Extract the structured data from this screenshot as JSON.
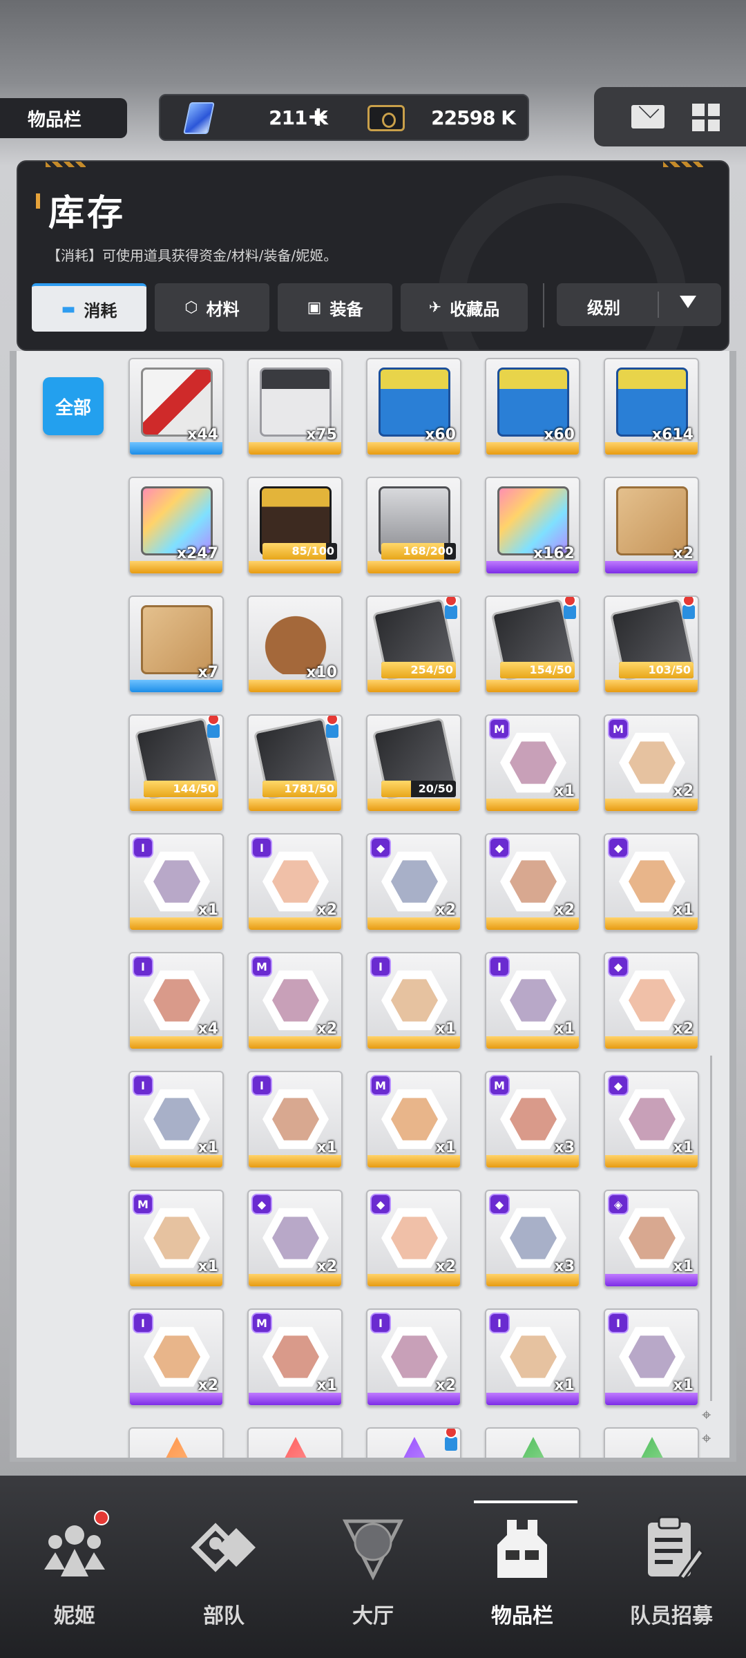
{
  "top": {
    "tab_title": "物品栏",
    "gems": "211 K",
    "gems_plus": "+",
    "credits": "22598 K"
  },
  "header": {
    "title": "库存",
    "description": "【消耗】可使用道具获得资金/材料/装备/妮姬。",
    "tabs": [
      {
        "label": "消耗",
        "icon": "ticket-icon"
      },
      {
        "label": "材料",
        "icon": "hexagon-icon"
      },
      {
        "label": "装备",
        "icon": "vest-icon"
      },
      {
        "label": "收藏品",
        "icon": "bird-icon"
      }
    ],
    "sort_label": "级别"
  },
  "filter_all": "全部",
  "items": [
    {
      "qty": "x44",
      "rarity": "blue",
      "art": "crate-red-icon"
    },
    {
      "qty": "x75",
      "rarity": "gold",
      "art": "crate-purple-icon"
    },
    {
      "qty": "x60",
      "rarity": "gold",
      "art": "blue-box-icon"
    },
    {
      "qty": "x60",
      "rarity": "gold",
      "art": "blue-box-icon"
    },
    {
      "qty": "x614",
      "rarity": "gold",
      "art": "blue-box-icon"
    },
    {
      "qty": "x247",
      "rarity": "gold",
      "art": "rainbow-case-icon"
    },
    {
      "progress": "85/100",
      "rarity": "gold",
      "art": "dark-case-icon"
    },
    {
      "progress": "168/200",
      "rarity": "gold",
      "art": "silver-case-icon"
    },
    {
      "qty": "x162",
      "rarity": "purple",
      "art": "rainbow-case-icon"
    },
    {
      "qty": "x2",
      "rarity": "purple",
      "art": "cardboard-box-icon"
    },
    {
      "qty": "x7",
      "rarity": "blue",
      "art": "cardboard-box-icon"
    },
    {
      "qty": "x10",
      "rarity": "gold",
      "art": "basket-icon"
    },
    {
      "progress": "254/50",
      "rarity": "gold",
      "art": "card-icon",
      "lock": true
    },
    {
      "progress": "154/50",
      "rarity": "gold",
      "art": "card-icon",
      "lock": true
    },
    {
      "progress": "103/50",
      "rarity": "gold",
      "art": "card-icon",
      "lock": true
    },
    {
      "progress": "144/50",
      "rarity": "gold",
      "art": "card-icon",
      "lock": true
    },
    {
      "progress": "1781/50",
      "rarity": "gold",
      "art": "card-icon",
      "lock": true
    },
    {
      "progress": "20/50",
      "rarity": "gold",
      "art": "card-icon"
    },
    {
      "qty": "x1",
      "rarity": "gold",
      "art": "portrait-icon",
      "badge": "M"
    },
    {
      "qty": "x2",
      "rarity": "gold",
      "art": "portrait-icon",
      "badge": "M"
    },
    {
      "qty": "x1",
      "rarity": "gold",
      "art": "portrait-icon",
      "badge": "I"
    },
    {
      "qty": "x2",
      "rarity": "gold",
      "art": "portrait-icon",
      "badge": "I"
    },
    {
      "qty": "x2",
      "rarity": "gold",
      "art": "portrait-icon",
      "badge": "◆"
    },
    {
      "qty": "x2",
      "rarity": "gold",
      "art": "portrait-icon",
      "badge": "◆"
    },
    {
      "qty": "x1",
      "rarity": "gold",
      "art": "portrait-icon",
      "badge": "◆"
    },
    {
      "qty": "x4",
      "rarity": "gold",
      "art": "portrait-icon",
      "badge": "I"
    },
    {
      "qty": "x2",
      "rarity": "gold",
      "art": "portrait-icon",
      "badge": "M"
    },
    {
      "qty": "x1",
      "rarity": "gold",
      "art": "portrait-icon",
      "badge": "I"
    },
    {
      "qty": "x1",
      "rarity": "gold",
      "art": "portrait-icon",
      "badge": "I"
    },
    {
      "qty": "x2",
      "rarity": "gold",
      "art": "portrait-icon",
      "badge": "◆"
    },
    {
      "qty": "x1",
      "rarity": "gold",
      "art": "portrait-icon",
      "badge": "I"
    },
    {
      "qty": "x1",
      "rarity": "gold",
      "art": "portrait-icon",
      "badge": "I"
    },
    {
      "qty": "x1",
      "rarity": "gold",
      "art": "portrait-icon",
      "badge": "M"
    },
    {
      "qty": "x3",
      "rarity": "gold",
      "art": "portrait-icon",
      "badge": "M"
    },
    {
      "qty": "x1",
      "rarity": "gold",
      "art": "portrait-icon",
      "badge": "◆"
    },
    {
      "qty": "x1",
      "rarity": "gold",
      "art": "portrait-icon",
      "badge": "M"
    },
    {
      "qty": "x2",
      "rarity": "gold",
      "art": "portrait-icon",
      "badge": "◆"
    },
    {
      "qty": "x2",
      "rarity": "gold",
      "art": "portrait-icon",
      "badge": "◆"
    },
    {
      "qty": "x3",
      "rarity": "gold",
      "art": "portrait-icon",
      "badge": "◆"
    },
    {
      "qty": "x1",
      "rarity": "purple",
      "art": "portrait-icon",
      "badge": "◈"
    },
    {
      "qty": "x2",
      "rarity": "purple",
      "art": "portrait-icon",
      "badge": "I"
    },
    {
      "qty": "x1",
      "rarity": "purple",
      "art": "portrait-icon",
      "badge": "M"
    },
    {
      "qty": "x2",
      "rarity": "purple",
      "art": "portrait-icon",
      "badge": "I"
    },
    {
      "qty": "x1",
      "rarity": "purple",
      "art": "portrait-icon",
      "badge": "I"
    },
    {
      "qty": "x1",
      "rarity": "purple",
      "art": "portrait-icon",
      "badge": "I"
    },
    {
      "rarity": "orange",
      "art": "orange-shard-icon"
    },
    {
      "rarity": "orange",
      "art": "red-shard-icon"
    },
    {
      "rarity": "purple",
      "art": "purple-shard-icon",
      "lock": true
    },
    {
      "rarity": "green",
      "art": "green-shard-icon"
    },
    {
      "rarity": "green",
      "art": "green-shard-icon"
    }
  ],
  "nav": [
    {
      "label": "妮姬",
      "icon": "nikke-group-icon",
      "dot": true
    },
    {
      "label": "部队",
      "icon": "squad-icon"
    },
    {
      "label": "大厅",
      "icon": "lobby-globe-icon"
    },
    {
      "label": "物品栏",
      "icon": "inventory-vest-icon",
      "active": true
    },
    {
      "label": "队员招募",
      "icon": "recruit-clipboard-icon"
    }
  ]
}
